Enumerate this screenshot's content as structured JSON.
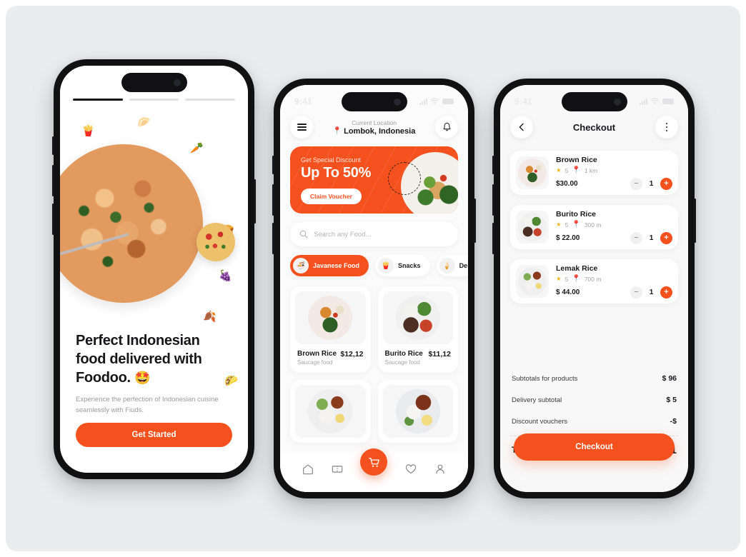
{
  "theme": {
    "accent": "#F4511E",
    "canvas_bg": "#EAECEE",
    "star": "#F5B521"
  },
  "status_bar": {
    "time": "9:41"
  },
  "onboarding": {
    "progress_steps": 3,
    "active_step": 1,
    "title": "Perfect Indonesian food delivered with Foodoo.",
    "title_emoji": "🤩",
    "subtitle": "Experience the perfection of Indonesian cuisine seamlessly with Fiuds.",
    "cta_label": "Get Started",
    "decor_icons": [
      "fries-icon",
      "dumpling-icon",
      "carrot-icon",
      "bread-icon",
      "grapes-icon",
      "leaf-icon",
      "taco-icon"
    ]
  },
  "home": {
    "menu_icon": "hamburger-menu-icon",
    "bell_icon": "bell-icon",
    "location_label": "Current Location",
    "location_city": "Lombok, Indonesia",
    "banner": {
      "eyebrow": "Get Special Discount",
      "headline": "Up To 50%",
      "button_label": "Claim Voucher"
    },
    "search": {
      "placeholder": "Search any Food...",
      "value": "",
      "icon": "search-icon"
    },
    "categories": [
      {
        "label": "Javanese Food",
        "emoji": "🍜",
        "active": true
      },
      {
        "label": "Snacks",
        "emoji": "🍟",
        "active": false
      },
      {
        "label": "Desse",
        "emoji": "🍦",
        "active": false
      }
    ],
    "foods": [
      {
        "name": "Brown Rice",
        "category": "Saucage food",
        "price": "$12,12"
      },
      {
        "name": "Burito Rice",
        "category": "Saucage food",
        "price": "$11,12"
      },
      {
        "name": "",
        "category": "",
        "price": ""
      },
      {
        "name": "",
        "category": "",
        "price": ""
      }
    ],
    "tabs": [
      {
        "icon": "home-icon",
        "active": true
      },
      {
        "icon": "ticket-icon",
        "active": false
      },
      {
        "icon": "cart-icon",
        "active": false
      },
      {
        "icon": "heart-icon",
        "active": false
      },
      {
        "icon": "profile-icon",
        "active": false
      }
    ]
  },
  "checkout": {
    "back_icon": "chevron-left-icon",
    "title": "Checkout",
    "more_icon": "more-vertical-icon",
    "items": [
      {
        "name": "Brown Rice",
        "rating": "5",
        "distance": "1 km",
        "price": "$30.00",
        "qty": "1"
      },
      {
        "name": "Burito Rice",
        "rating": "5",
        "distance": "300 m",
        "price": "$ 22.00",
        "qty": "1"
      },
      {
        "name": "Lemak Rice",
        "rating": "5",
        "distance": "700 m",
        "price": "$ 44.00",
        "qty": "1"
      }
    ],
    "summary": [
      {
        "label": "Subtotals for products",
        "value": "$ 96"
      },
      {
        "label": "Delivery subtotal",
        "value": "$ 5"
      },
      {
        "label": "Discount vouchers",
        "value": "-$"
      }
    ],
    "total_label": "Total",
    "total_value": "$101",
    "button_label": "Checkout"
  }
}
